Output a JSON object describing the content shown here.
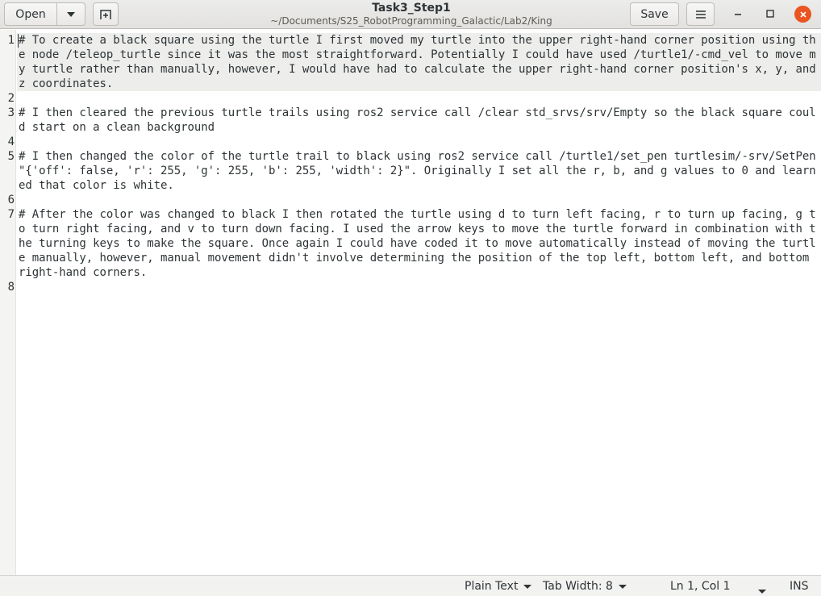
{
  "header": {
    "open_label": "Open",
    "title": "Task3_Step1",
    "subtitle": "~/Documents/S25_RobotProgramming_Galactic/Lab2/King",
    "save_label": "Save"
  },
  "editor": {
    "lines": [
      {
        "number": "1",
        "text": "# To create a black square using the turtle I first moved my turtle into the upper right-hand corner position using the node /teleop_turtle since it was the most straightforward. Potentially I could have used /turtle1/-cmd_vel to move my turtle rather than manually, however, I would have had to calculate the upper right-hand corner position's x, y, and z coordinates."
      },
      {
        "number": "2",
        "text": ""
      },
      {
        "number": "3",
        "text": "# I then cleared the previous turtle trails using ros2 service call /clear std_srvs/srv/Empty so the black square could start on a clean background"
      },
      {
        "number": "4",
        "text": ""
      },
      {
        "number": "5",
        "text": "# I then changed the color of the turtle trail to black using ros2 service call /turtle1/set_pen turtlesim/-srv/SetPen \"{'off': false, 'r': 255, 'g': 255, 'b': 255, 'width': 2}\". Originally I set all the r, b, and g values to 0 and learned that color is white."
      },
      {
        "number": "6",
        "text": ""
      },
      {
        "number": "7",
        "text": "# After the color was changed to black I then rotated the turtle using d to turn left facing, r to turn up facing, g to turn right facing, and v to turn down facing. I used the arrow keys to move the turtle forward in combination with the turning keys to make the square. Once again I could have coded it to move automatically instead of moving the turtle manually, however, manual movement didn't involve determining the position of the top left, bottom left, and bottom right-hand corners."
      },
      {
        "number": "8",
        "text": ""
      }
    ]
  },
  "statusbar": {
    "language": "Plain Text",
    "tab_width": "Tab Width: 8",
    "position": "Ln 1, Col 1",
    "insert_mode": "INS"
  }
}
